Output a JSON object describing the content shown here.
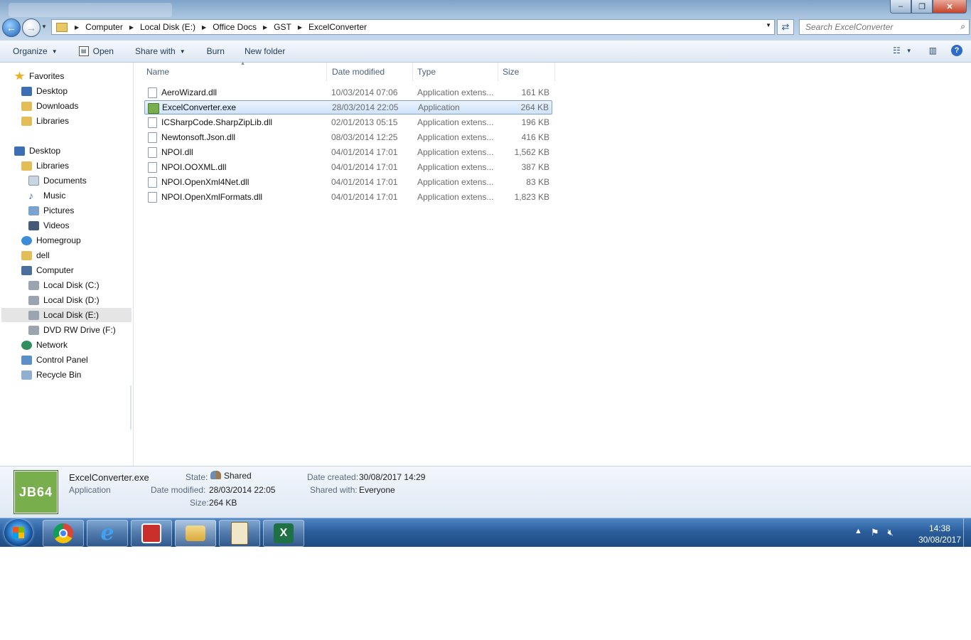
{
  "address": {
    "crumbs": [
      "Computer",
      "Local Disk (E:)",
      "Office Docs",
      "GST",
      "ExcelConverter"
    ]
  },
  "search": {
    "placeholder": "Search ExcelConverter"
  },
  "toolbar": {
    "organize": "Organize",
    "open": "Open",
    "share_with": "Share with",
    "burn": "Burn",
    "new_folder": "New folder"
  },
  "nav": [
    {
      "label": "Favorites",
      "icon": "star-icon",
      "color": "#f2b01e"
    },
    {
      "label": "Desktop",
      "icon": "desktop-icon",
      "color": "#3d6db3"
    },
    {
      "label": "Downloads",
      "icon": "downloads-folder-icon",
      "color": "#e3bd55"
    },
    {
      "label": "Libraries",
      "icon": "libraries-icon",
      "color": "#e3bd55"
    },
    {
      "label": "Desktop",
      "icon": "desktop-icon",
      "color": "#3d6db3"
    },
    {
      "label": "Libraries",
      "icon": "libraries-icon",
      "color": "#e3bd55"
    },
    {
      "label": "Documents",
      "icon": "documents-icon",
      "color": "#c9d5e3"
    },
    {
      "label": "Music",
      "icon": "music-icon",
      "color": "#2f6fc4"
    },
    {
      "label": "Pictures",
      "icon": "pictures-icon",
      "color": "#7aa3cf"
    },
    {
      "label": "Videos",
      "icon": "videos-icon",
      "color": "#445b78"
    },
    {
      "label": "Homegroup",
      "icon": "homegroup-icon",
      "color": "#3c8cd8"
    },
    {
      "label": "dell",
      "icon": "user-folder-icon",
      "color": "#e3bd55"
    },
    {
      "label": "Computer",
      "icon": "computer-icon",
      "color": "#4a6e9e"
    },
    {
      "label": "Local Disk (C:)",
      "icon": "drive-icon",
      "color": "#9aa5b0"
    },
    {
      "label": "Local Disk (D:)",
      "icon": "drive-icon",
      "color": "#9aa5b0"
    },
    {
      "label": "Local Disk (E:)",
      "icon": "drive-icon",
      "color": "#9aa5b0"
    },
    {
      "label": "DVD RW Drive (F:)",
      "icon": "dvd-drive-icon",
      "color": "#9aa5b0"
    },
    {
      "label": "Network",
      "icon": "network-icon",
      "color": "#2f8f5e"
    },
    {
      "label": "Control Panel",
      "icon": "control-panel-icon",
      "color": "#5b8fc9"
    },
    {
      "label": "Recycle Bin",
      "icon": "recycle-bin-icon",
      "color": "#8fb0d0"
    }
  ],
  "columns": {
    "name": "Name",
    "date": "Date modified",
    "type": "Type",
    "size": "Size"
  },
  "files": [
    {
      "name": "AeroWizard.dll",
      "date": "10/03/2014 07:06",
      "type": "Application extens...",
      "size": "161 KB"
    },
    {
      "name": "ExcelConverter.exe",
      "date": "28/03/2014 22:05",
      "type": "Application",
      "size": "264 KB"
    },
    {
      "name": "ICSharpCode.SharpZipLib.dll",
      "date": "02/01/2013 05:15",
      "type": "Application extens...",
      "size": "196 KB"
    },
    {
      "name": "Newtonsoft.Json.dll",
      "date": "08/03/2014 12:25",
      "type": "Application extens...",
      "size": "416 KB"
    },
    {
      "name": "NPOI.dll",
      "date": "04/01/2014 17:01",
      "type": "Application extens...",
      "size": "1,562 KB"
    },
    {
      "name": "NPOI.OOXML.dll",
      "date": "04/01/2014 17:01",
      "type": "Application extens...",
      "size": "387 KB"
    },
    {
      "name": "NPOI.OpenXml4Net.dll",
      "date": "04/01/2014 17:01",
      "type": "Application extens...",
      "size": "83 KB"
    },
    {
      "name": "NPOI.OpenXmlFormats.dll",
      "date": "04/01/2014 17:01",
      "type": "Application extens...",
      "size": "1,823 KB"
    }
  ],
  "details": {
    "thumb_text": "JB64",
    "file_name": "ExcelConverter.exe",
    "file_type": "Application",
    "state_label": "State:",
    "state_value": "Shared",
    "modified_label": "Date modified:",
    "modified_value": "28/03/2014 22:05",
    "size_label": "Size:",
    "size_value": "264 KB",
    "created_label": "Date created:",
    "created_value": "30/08/2017 14:29",
    "shared_label": "Shared with:",
    "shared_value": "Everyone"
  },
  "taskbar": {
    "apps": [
      {
        "name": "chrome",
        "color": "#db4437"
      },
      {
        "name": "internet-explorer",
        "color": "#1f7fd6"
      },
      {
        "name": "pdf-reader",
        "color": "#c9302c"
      },
      {
        "name": "windows-explorer",
        "color": "#e8c35a"
      },
      {
        "name": "tally-erp",
        "color": "#f0e6c8"
      },
      {
        "name": "excel",
        "color": "#1e7145"
      }
    ],
    "time": "14:38",
    "date": "30/08/2017"
  }
}
